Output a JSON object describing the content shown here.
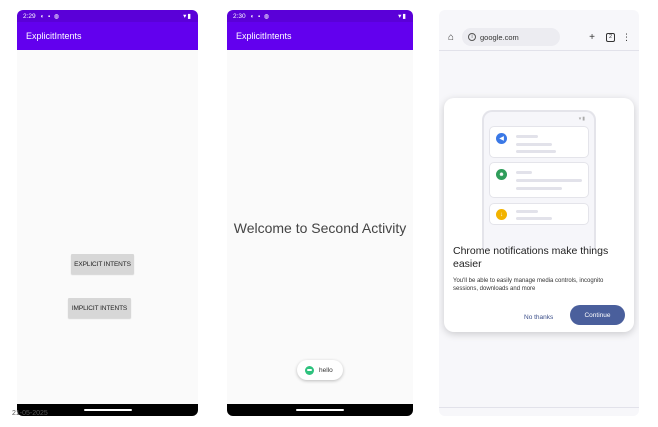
{
  "phone1": {
    "status_time": "2:29",
    "app_title": "ExplicitIntents",
    "explicit_button": "EXPLICIT INTENTS",
    "implicit_button": "IMPLICIT INTENTS"
  },
  "date_stamp": "21-05-2025",
  "phone2": {
    "status_time": "2:30",
    "app_title": "ExplicitIntents",
    "welcome_text": "Welcome to Second Activity",
    "toast_text": "hello"
  },
  "chrome": {
    "url": "google.com",
    "tab_count": "2",
    "dialog": {
      "title": "Chrome notifications make things easier",
      "body": "You'll be able to easily manage media controls, incognito sessions, downloads and more",
      "no_thanks": "No thanks",
      "continue": "Continue"
    }
  },
  "colors": {
    "status_bar": "#5a00d8",
    "app_bar": "#6200ee",
    "continue_button": "#4a5f9c"
  },
  "icons": [
    "home-icon",
    "info-icon",
    "plus-icon",
    "tab-switcher-icon",
    "more-vert-icon",
    "wifi-icon",
    "battery-icon",
    "speaker-icon",
    "chat-icon",
    "download-icon"
  ]
}
